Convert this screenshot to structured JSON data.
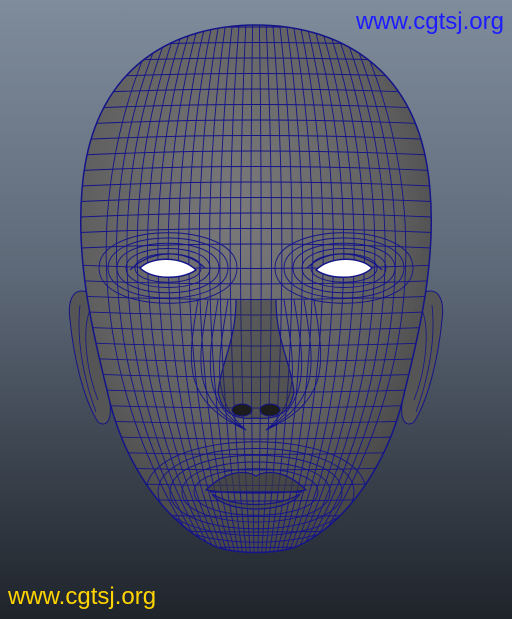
{
  "watermark": {
    "top_text": "www.cgtsj.org",
    "bottom_text": "www.cgtsj.org",
    "top_color": "#1c1cff",
    "bottom_color": "#ffd400"
  },
  "scene": {
    "subject": "polygon-wireframe-head",
    "background_top": "#7f8c9b",
    "background_bottom": "#1f242b",
    "mesh_fill": "#6b6b6b",
    "wire_color": "#14148a",
    "eye_color": "#ffffff"
  }
}
